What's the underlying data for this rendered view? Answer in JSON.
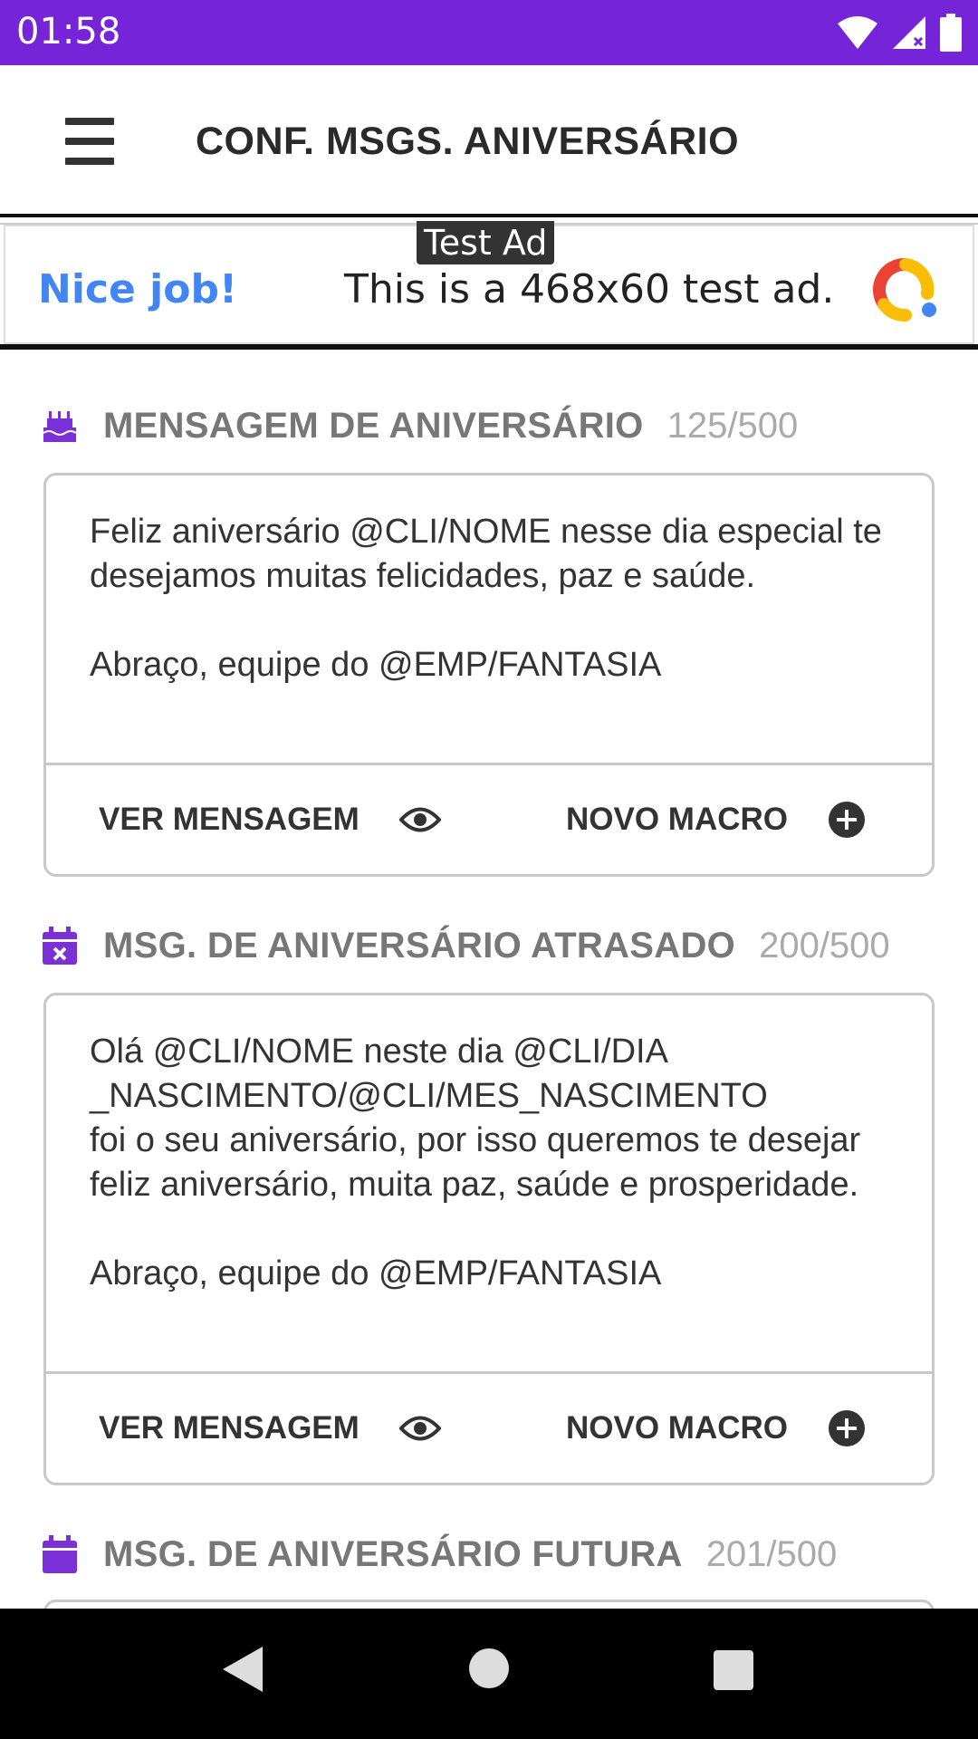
{
  "status_bar": {
    "time": "01:58"
  },
  "app_bar": {
    "title": "CONF. MSGS. ANIVERSÁRIO"
  },
  "ad": {
    "label": "Test Ad",
    "headline": "Nice job!",
    "text": "This is a 468x60 test ad."
  },
  "sections": [
    {
      "icon": "birthday-cake-icon",
      "title": "MENSAGEM DE ANIVERSÁRIO",
      "count": "125/500",
      "message": "Feliz aniversário @CLI/NOME nesse dia especial te desejamos muitas felicidades, paz e saúde.\n\nAbraço, equipe do @EMP/FANTASIA",
      "view_label": "VER MENSAGEM",
      "macro_label": "NOVO MACRO"
    },
    {
      "icon": "calendar-x-icon",
      "title": "MSG. DE ANIVERSÁRIO ATRASADO",
      "count": "200/500",
      "message": "Olá @CLI/NOME neste dia @CLI/DIA\n_NASCIMENTO/@CLI/MES_NASCIMENTO\nfoi o seu aniversário, por isso queremos te desejar feliz aniversário, muita paz, saúde e prosperidade.\n\nAbraço, equipe do @EMP/FANTASIA",
      "view_label": "VER MENSAGEM",
      "macro_label": "NOVO MACRO"
    },
    {
      "icon": "calendar-icon",
      "title": "MSG. DE ANIVERSÁRIO FUTURA",
      "count": "201/500"
    }
  ],
  "colors": {
    "status_bar": "#7524d8",
    "accent_icon": "#7b2fd6",
    "section_title": "#777777",
    "section_count": "#aaaaaa"
  }
}
